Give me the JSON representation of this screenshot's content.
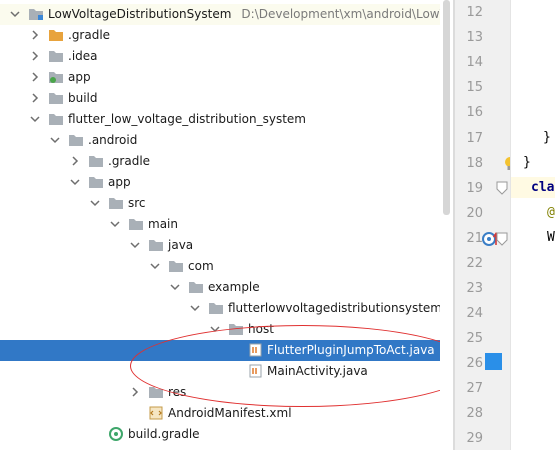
{
  "tree": {
    "project_name": "LowVoltageDistributionSystem",
    "project_path": "D:\\Development\\xm\\android\\LowVolt",
    "items": [
      {
        "label": ".gradle"
      },
      {
        "label": ".idea"
      },
      {
        "label": "app"
      },
      {
        "label": "build"
      },
      {
        "label": "flutter_low_voltage_distribution_system"
      },
      {
        "label": ".android"
      },
      {
        "label": ".gradle"
      },
      {
        "label": "app"
      },
      {
        "label": "src"
      },
      {
        "label": "main"
      },
      {
        "label": "java"
      },
      {
        "label": "com"
      },
      {
        "label": "example"
      },
      {
        "label": "flutterlowvoltagedistributionsystem"
      },
      {
        "label": "host"
      },
      {
        "label": "FlutterPluginJumpToAct.java"
      },
      {
        "label": "MainActivity.java"
      },
      {
        "label": "res"
      },
      {
        "label": "AndroidManifest.xml"
      },
      {
        "label": "build.gradle"
      }
    ]
  },
  "editor": {
    "line_numbers": [
      "12",
      "13",
      "14",
      "15",
      "16",
      "17",
      "18",
      "19",
      "20",
      "21",
      "22",
      "23",
      "24",
      "25",
      "26",
      "27",
      "28",
      "29"
    ],
    "code": {
      "line17": "}",
      "line18": "}",
      "line19": "cla",
      "line20": "@",
      "line21": "W"
    }
  },
  "colors": {
    "selection": "#3178c6",
    "annotation_ellipse": "#e03030",
    "folder": "#a9b0b7",
    "gradle_folder": "#e8a33d"
  }
}
